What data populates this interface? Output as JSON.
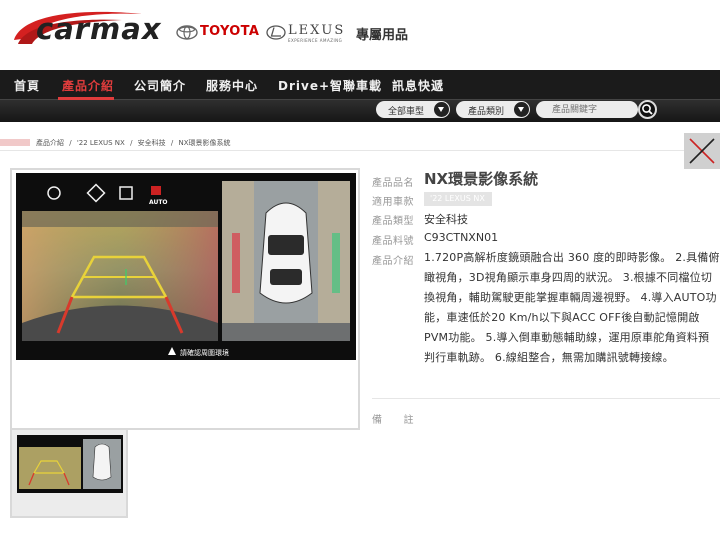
{
  "header": {
    "logo_text": "carmax",
    "toyota": "TOYOTA",
    "lexus": "LEXUS",
    "lexus_tagline": "EXPERIENCE AMAZING",
    "tagline": "專屬用品"
  },
  "nav": {
    "items": [
      "首頁",
      "產品介紹",
      "公司簡介",
      "服務中心",
      "Drive+智聯車載",
      "訊息快遞"
    ],
    "active_index": 1,
    "active_color": "#e03c3c"
  },
  "search": {
    "model_select": "全部車型",
    "category_select": "產品類別",
    "keyword_placeholder": "產品關鍵字"
  },
  "breadcrumb": [
    "產品介紹",
    "/",
    "'22 LEXUS NX",
    "/",
    "安全科技",
    "/",
    "NX環景影像系統"
  ],
  "screen_overlay": {
    "auto_label": "AUTO",
    "warning": "請確認周圍環境"
  },
  "product": {
    "name_label": "產品品名",
    "name": "NX環景影像系統",
    "model_label": "適用車款",
    "model": "'22 LEXUS NX",
    "type_label": "產品類型",
    "type": "安全科技",
    "part_label": "產品料號",
    "part_number": "C93CTNXN01",
    "intro_label": "產品介紹",
    "description": "1.720P高解析度鏡頭融合出 360 度的即時影像。 2.具備俯瞰視角，3D視角顯示車身四周的狀況。 3.根據不同檔位切換視角，輔助駕駛更能掌握車輛周邊視野。 4.導入AUTO功能，車速低於20 Km/h以下與ACC OFF後自動記憶開啟PVM功能。 5.導入倒車動態輔助線，運用原車舵角資料預判行車軌跡。 6.線組整合，無需加購訊號轉接線。",
    "notes_label": "備　　註"
  },
  "colors": {
    "nav_bg": "#1b1b1b",
    "brand_red": "#cc0000"
  }
}
